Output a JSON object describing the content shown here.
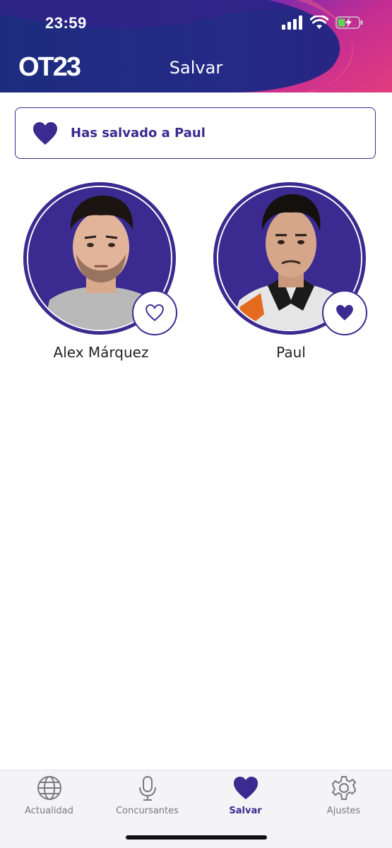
{
  "status_bar": {
    "time": "23:59"
  },
  "header": {
    "logo_text": "OT23",
    "title": "Salvar"
  },
  "banner": {
    "text": "Has salvado a Paul",
    "icon": "heart-filled-icon"
  },
  "contestants": [
    {
      "name": "Alex Márquez",
      "saved": false,
      "icon": "heart-outline-icon"
    },
    {
      "name": "Paul",
      "saved": true,
      "icon": "heart-filled-icon"
    }
  ],
  "tabs": [
    {
      "label": "Actualidad",
      "icon": "globe-icon",
      "active": false
    },
    {
      "label": "Concursantes",
      "icon": "microphone-icon",
      "active": false
    },
    {
      "label": "Salvar",
      "icon": "heart-filled-icon",
      "active": true
    },
    {
      "label": "Ajustes",
      "icon": "gear-icon",
      "active": false
    }
  ],
  "colors": {
    "accent": "#3b2a8f",
    "header_bg": "#1f2a78",
    "header_swoosh": "#c8329a"
  }
}
